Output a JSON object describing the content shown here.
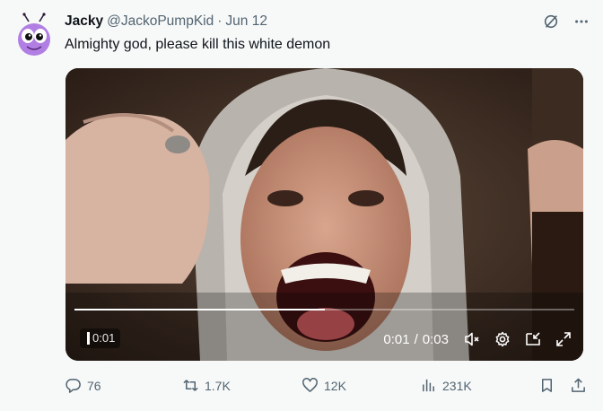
{
  "author": {
    "name": "Jacky",
    "handle": "@JackoPumpKid",
    "separator": "·",
    "date": "Jun 12"
  },
  "tweet": {
    "text": "Almighty god, please kill this white demon"
  },
  "video": {
    "elapsed_badge": "0:01",
    "current_time": "0:01",
    "time_separator": "/",
    "duration": "0:03",
    "progress_fraction": 0.5
  },
  "actions": {
    "replies": "76",
    "reposts": "1.7K",
    "likes": "12K",
    "views": "231K"
  },
  "icons": {
    "grok": "slashed-circle-icon",
    "more": "more-dots-icon",
    "mute": "speaker-muted-icon",
    "settings": "gear-icon",
    "dock": "dock-icon",
    "fullscreen": "fullscreen-icon",
    "reply": "reply-icon",
    "repost": "repost-icon",
    "like": "heart-icon",
    "views": "views-chart-icon",
    "bookmark": "bookmark-icon",
    "share": "share-icon"
  },
  "colors": {
    "background": "#f7f9f9",
    "text": "#0f1419",
    "muted": "#536471",
    "avatar": "#b17fe3"
  }
}
